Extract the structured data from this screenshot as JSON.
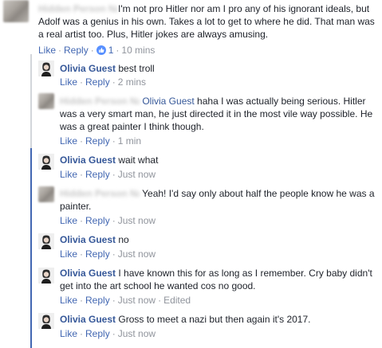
{
  "comments": [
    {
      "author": "",
      "author_hidden": "Hidden Person Name",
      "text": "I'm not pro Hitler nor am I pro any of his ignorant ideals, but Adolf was a genius in his own. Takes a lot to get to where he did. That man was a real artist too. Plus, Hitler jokes are always amusing.",
      "like": "Like",
      "reply": "Reply",
      "reactions": "1",
      "time": "10 mins"
    },
    {
      "author": "Olivia Guest",
      "text": "best troll",
      "like": "Like",
      "reply": "Reply",
      "time": "2 mins"
    },
    {
      "author_hidden": "Hidden Person Name",
      "mention": "Olivia Guest",
      "text": "haha I was actually being serious. Hitler was a very smart man, he just directed it in the most vile way possible. He was a great painter I think though.",
      "like": "Like",
      "reply": "Reply",
      "time": "1 min"
    },
    {
      "author": "Olivia Guest",
      "text": "wait what",
      "like": "Like",
      "reply": "Reply",
      "time": "Just now"
    },
    {
      "author_hidden": "Hidden Person Name",
      "text": "Yeah! I'd say only about half the people know he was a painter.",
      "like": "Like",
      "reply": "Reply",
      "time": "Just now"
    },
    {
      "author": "Olivia Guest",
      "text": "no",
      "like": "Like",
      "reply": "Reply",
      "time": "Just now"
    },
    {
      "author": "Olivia Guest",
      "text": "I have known this for as long as I remember. Cry baby didn't get into the art school he wanted cos no good.",
      "like": "Like",
      "reply": "Reply",
      "time": "Just now",
      "edited": "Edited"
    },
    {
      "author": "Olivia Guest",
      "text": "Gross to meet a nazi but then again it's 2017.",
      "like": "Like",
      "reply": "Reply",
      "time": "Just now"
    }
  ],
  "colors": {
    "link": "#4267b2",
    "name": "#365899",
    "meta": "#90949c",
    "text": "#1d2129",
    "thread": "#4267b2"
  }
}
